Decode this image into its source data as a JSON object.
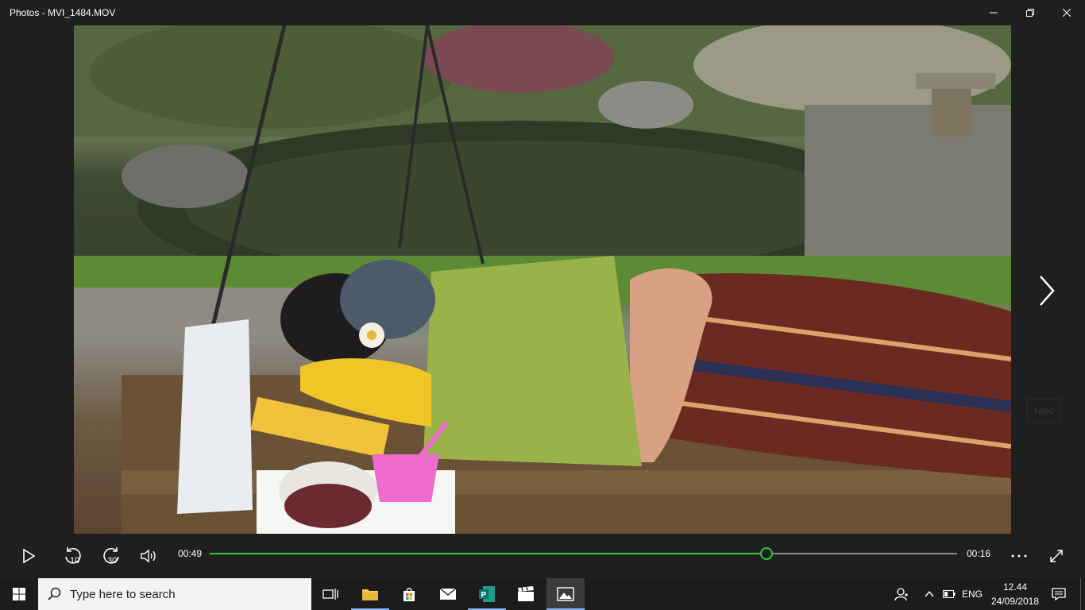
{
  "window": {
    "title": "Photos - MVI_1484.MOV",
    "minimize_icon": "minimize-icon",
    "restore_icon": "restore-icon",
    "close_icon": "close-icon"
  },
  "viewer": {
    "next_tooltip": "Next",
    "next_icon": "chevron-right-icon"
  },
  "controls": {
    "elapsed": "00:49",
    "remaining": "00:16",
    "rewind_label": "10",
    "forward_label": "30",
    "progress_fraction": 0.745,
    "accent": "#2ecc40",
    "icons": [
      "play-icon",
      "rewind-10-icon",
      "forward-30-icon",
      "volume-icon",
      "more-icon",
      "fullscreen-icon"
    ]
  },
  "taskbar": {
    "search_placeholder": "Type here to search",
    "language": "ENG",
    "time": "12.44",
    "date": "24/09/2018",
    "apps": [
      "task-view-icon",
      "file-explorer-icon",
      "store-icon",
      "mail-icon",
      "publisher-icon",
      "movies-icon",
      "photos-icon"
    ]
  }
}
